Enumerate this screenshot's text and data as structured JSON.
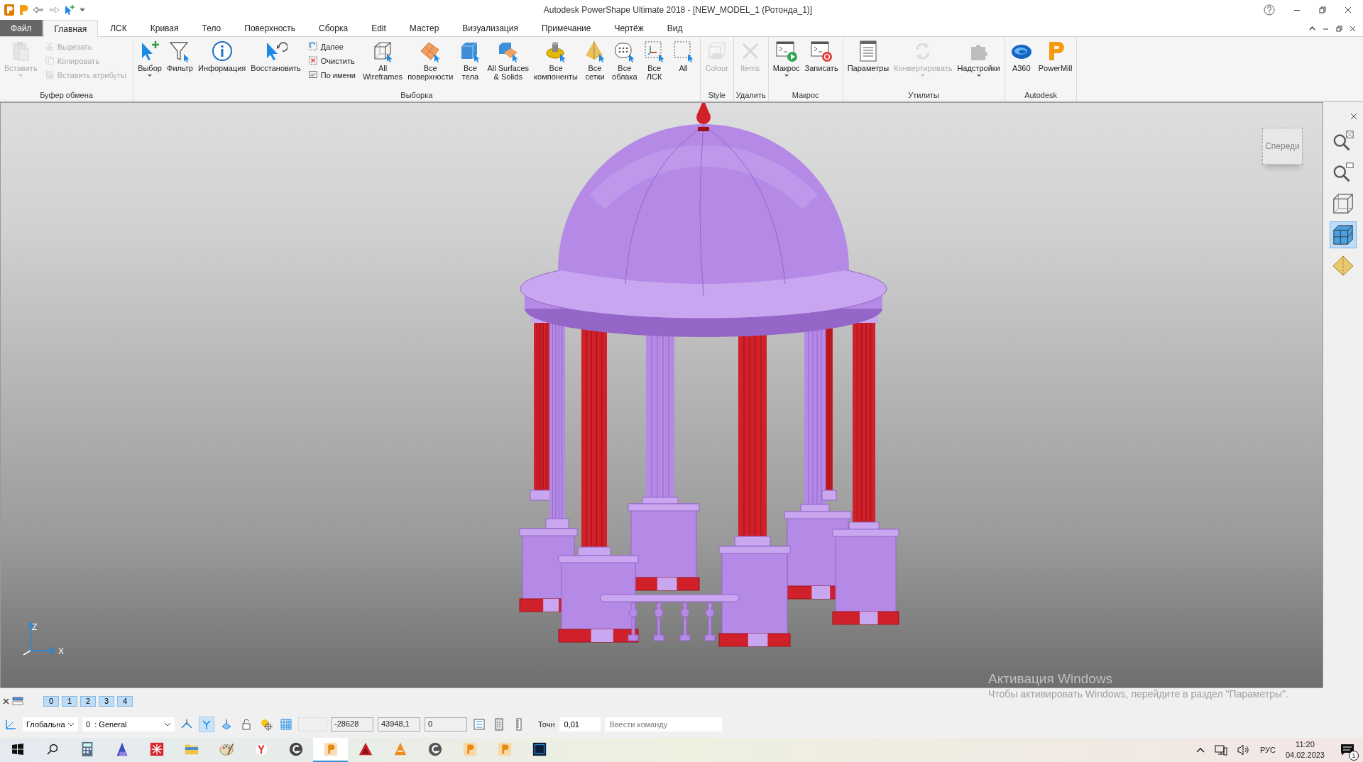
{
  "window": {
    "title": "Autodesk PowerShape Ultimate 2018 - [NEW_MODEL_1 (Ротонда_1)]"
  },
  "tabs": [
    {
      "label": "Файл",
      "kind": "file",
      "selected": false
    },
    {
      "label": "Главная",
      "kind": "tab",
      "selected": true
    },
    {
      "label": "ЛСК",
      "kind": "tab",
      "selected": false
    },
    {
      "label": "Кривая",
      "kind": "tab",
      "selected": false
    },
    {
      "label": "Тело",
      "kind": "tab",
      "selected": false
    },
    {
      "label": "Поверхность",
      "kind": "tab",
      "selected": false
    },
    {
      "label": "Сборка",
      "kind": "tab",
      "selected": false
    },
    {
      "label": "Edit",
      "kind": "tab",
      "selected": false
    },
    {
      "label": "Мастер",
      "kind": "tab",
      "selected": false
    },
    {
      "label": "Визуализация",
      "kind": "tab",
      "selected": false
    },
    {
      "label": "Примечание",
      "kind": "tab",
      "selected": false
    },
    {
      "label": "Чертёж",
      "kind": "tab",
      "selected": false
    },
    {
      "label": "Вид",
      "kind": "tab",
      "selected": false
    }
  ],
  "ribbon": {
    "groups": [
      {
        "label": "Буфер обмена",
        "items": [
          {
            "label": "Вставить",
            "kind": "large",
            "disabled": true,
            "dropdown": true
          },
          {
            "label": "Вырезать",
            "kind": "small",
            "disabled": true,
            "dropdown": false
          },
          {
            "label": "Копировать",
            "kind": "small",
            "disabled": true,
            "dropdown": false
          },
          {
            "label": "Вставить атрибуты",
            "kind": "small",
            "disabled": true,
            "dropdown": false
          }
        ]
      },
      {
        "label": "Выборка",
        "items": [
          {
            "label": "Выбор",
            "kind": "large",
            "disabled": false,
            "dropdown": true
          },
          {
            "label": "Фильтр",
            "kind": "large",
            "disabled": false,
            "dropdown": false
          },
          {
            "label": "Информация",
            "kind": "large",
            "disabled": false,
            "dropdown": false
          },
          {
            "label": "Восстановить",
            "kind": "large",
            "disabled": false,
            "dropdown": false
          },
          {
            "label": "Далее",
            "kind": "small",
            "disabled": false,
            "dropdown": false
          },
          {
            "label": "Очистить",
            "kind": "small",
            "disabled": false,
            "dropdown": false
          },
          {
            "label": "По имени",
            "kind": "small",
            "disabled": false,
            "dropdown": false
          },
          {
            "label": "All\nWireframes",
            "kind": "large",
            "disabled": false,
            "dropdown": false
          },
          {
            "label": "Все\nповерхности",
            "kind": "large",
            "disabled": false,
            "dropdown": false
          },
          {
            "label": "Все\nтела",
            "kind": "large",
            "disabled": false,
            "dropdown": false
          },
          {
            "label": "All Surfaces\n& Solids",
            "kind": "large",
            "disabled": false,
            "dropdown": false
          },
          {
            "label": "Все\nкомпоненты",
            "kind": "large",
            "disabled": false,
            "dropdown": false
          },
          {
            "label": "Все\nсетки",
            "kind": "large",
            "disabled": false,
            "dropdown": false
          },
          {
            "label": "Все\nоблака",
            "kind": "large",
            "disabled": false,
            "dropdown": false
          },
          {
            "label": "Все\nЛСК",
            "kind": "large",
            "disabled": false,
            "dropdown": false
          },
          {
            "label": "All",
            "kind": "large",
            "disabled": false,
            "dropdown": false
          }
        ]
      },
      {
        "label": "Style",
        "items": [
          {
            "label": "Colour",
            "kind": "large",
            "disabled": true,
            "dropdown": false
          }
        ]
      },
      {
        "label": "Удалить",
        "items": [
          {
            "label": "Items",
            "kind": "large",
            "disabled": true,
            "dropdown": false
          }
        ]
      },
      {
        "label": "Макрос",
        "items": [
          {
            "label": "Макрос",
            "kind": "large",
            "disabled": false,
            "dropdown": true
          },
          {
            "label": "Записать",
            "kind": "large",
            "disabled": false,
            "dropdown": false
          }
        ]
      },
      {
        "label": "Утилиты",
        "items": [
          {
            "label": "Параметры",
            "kind": "large",
            "disabled": false,
            "dropdown": false
          },
          {
            "label": "Конвертировать",
            "kind": "large",
            "disabled": true,
            "dropdown": true
          },
          {
            "label": "Надстройки",
            "kind": "large",
            "disabled": false,
            "dropdown": true
          }
        ]
      },
      {
        "label": "Autodesk",
        "items": [
          {
            "label": "A360",
            "kind": "large",
            "disabled": false,
            "dropdown": false
          },
          {
            "label": "PowerMill",
            "kind": "large",
            "disabled": false,
            "dropdown": false
          }
        ]
      }
    ]
  },
  "viewport": {
    "view_cube_label": "Спереди",
    "axis_z": "Z",
    "axis_x": "X"
  },
  "view_toolbar": {
    "items": [
      {
        "selected": false
      },
      {
        "selected": false
      },
      {
        "selected": false
      },
      {
        "selected": true
      },
      {
        "selected": false
      }
    ]
  },
  "layer_bar": {
    "layers": [
      "0",
      "1",
      "2",
      "3",
      "4"
    ]
  },
  "status_bar": {
    "coordinate_system": "Глобальна",
    "layer": "0  : General",
    "coord_fields": [
      "-28628",
      "43948,1",
      "0"
    ],
    "tolerance_label": "Точн",
    "tolerance": "0,01",
    "command_placeholder": "Ввести команду"
  },
  "taskbar": {
    "apps": [
      {
        "selected": false
      },
      {
        "selected": false
      },
      {
        "selected": false
      },
      {
        "selected": false
      },
      {
        "selected": false
      },
      {
        "selected": false
      },
      {
        "selected": false
      },
      {
        "selected": true
      },
      {
        "selected": false
      },
      {
        "selected": false
      },
      {
        "selected": false
      },
      {
        "selected": false
      },
      {
        "selected": false
      },
      {
        "selected": false
      }
    ],
    "language": "РУС",
    "time": "11:20",
    "date": "04.02.2023",
    "notifications": "1"
  },
  "activation_notice": {
    "title": "Активация Windows",
    "text": "Чтобы активировать Windows, перейдите в раздел \"Параметры\"."
  }
}
